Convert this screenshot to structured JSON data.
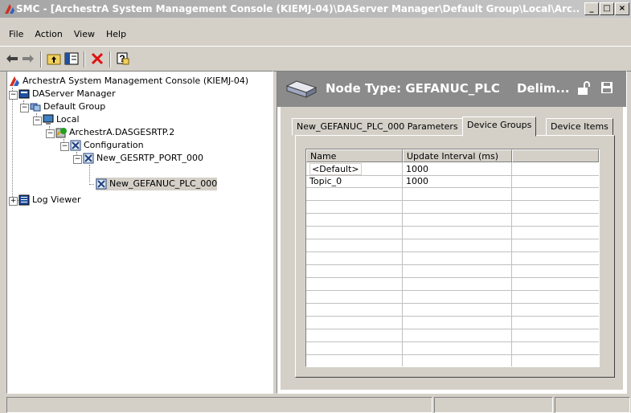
{
  "window": {
    "title": "SMC - [ArchestrA System Management Console (KIEMJ-04)\\DAServer Manager\\Default Group\\Local\\Arc...",
    "minimize": "_",
    "maximize": "□",
    "close": "×"
  },
  "menu": [
    "File",
    "Action",
    "View",
    "Help"
  ],
  "toolbar": {
    "back": "back-arrow",
    "forward": "forward-arrow",
    "up": "up-folder",
    "show_hide": "show-hide-tree",
    "delete": "delete",
    "help": "help"
  },
  "tree": {
    "root": "ArchestrA System Management Console (KIEMJ-04)",
    "daserver_manager": "DAServer Manager",
    "default_group": "Default Group",
    "local": "Local",
    "dasgesrtp": "ArchestrA.DASGESRTP.2",
    "configuration": "Configuration",
    "port": "New_GESRTP_PORT_000",
    "plc": "New_GEFANUC_PLC_000",
    "log_viewer": "Log Viewer"
  },
  "detail": {
    "node_type": "Node Type: GEFANUC_PLC",
    "delim": "Delim...",
    "tabs": [
      "New_GEFANUC_PLC_000 Parameters",
      "Device Groups",
      "Device Items"
    ],
    "active_tab": 1,
    "columns": [
      "Name",
      "Update Interval (ms)"
    ],
    "rows": [
      {
        "name": "<Default>",
        "interval": "1000"
      },
      {
        "name": "Topic_0",
        "interval": "1000"
      }
    ]
  },
  "colors": {
    "titlebar": "#b4b4b4",
    "header": "#8b8b8b",
    "background": "#d4d0c8"
  }
}
